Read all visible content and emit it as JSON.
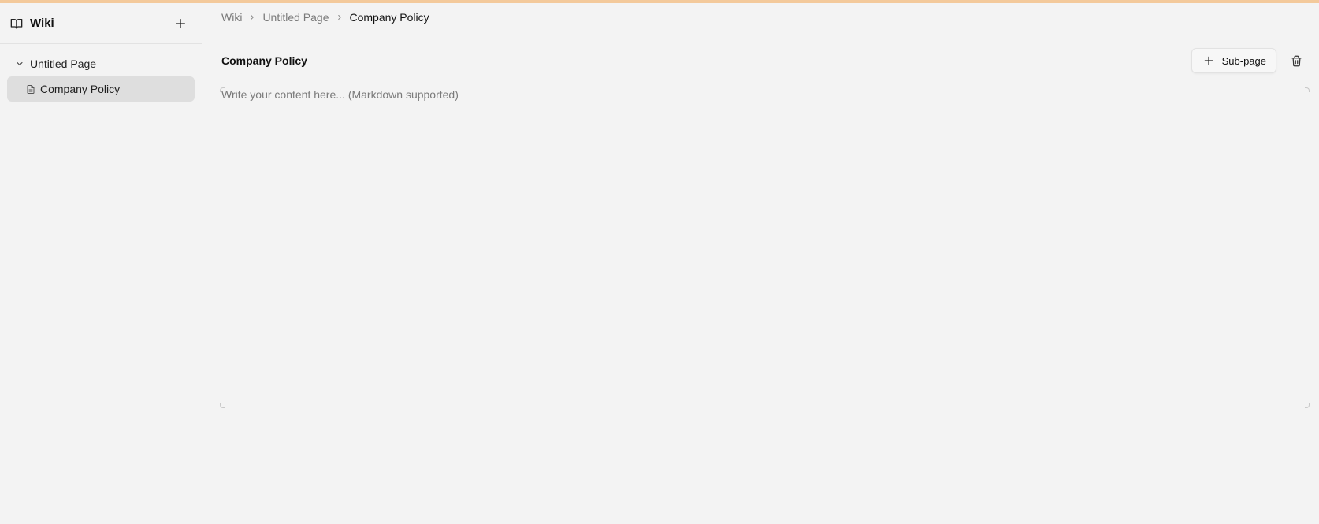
{
  "sidebar": {
    "title": "Wiki",
    "tree": [
      {
        "label": "Untitled Page",
        "expanded": true
      },
      {
        "label": "Company Policy",
        "selected": true
      }
    ]
  },
  "breadcrumb": [
    "Wiki",
    "Untitled Page",
    "Company Policy"
  ],
  "page": {
    "title": "Company Policy",
    "subpage_label": "Sub-page",
    "editor_placeholder": "Write your content here... (Markdown supported)",
    "editor_value": ""
  },
  "icons": {
    "wiki": "book-icon",
    "add": "plus-icon",
    "expand": "chevron-down-icon",
    "page": "document-icon",
    "breadcrumb_sep": "chevron-right-icon",
    "delete": "trash-icon"
  },
  "colors": {
    "background": "#f3f3f3",
    "selected_row": "#dedede",
    "top_accent": "#f3c99b",
    "muted_text": "#7a7a7a"
  }
}
